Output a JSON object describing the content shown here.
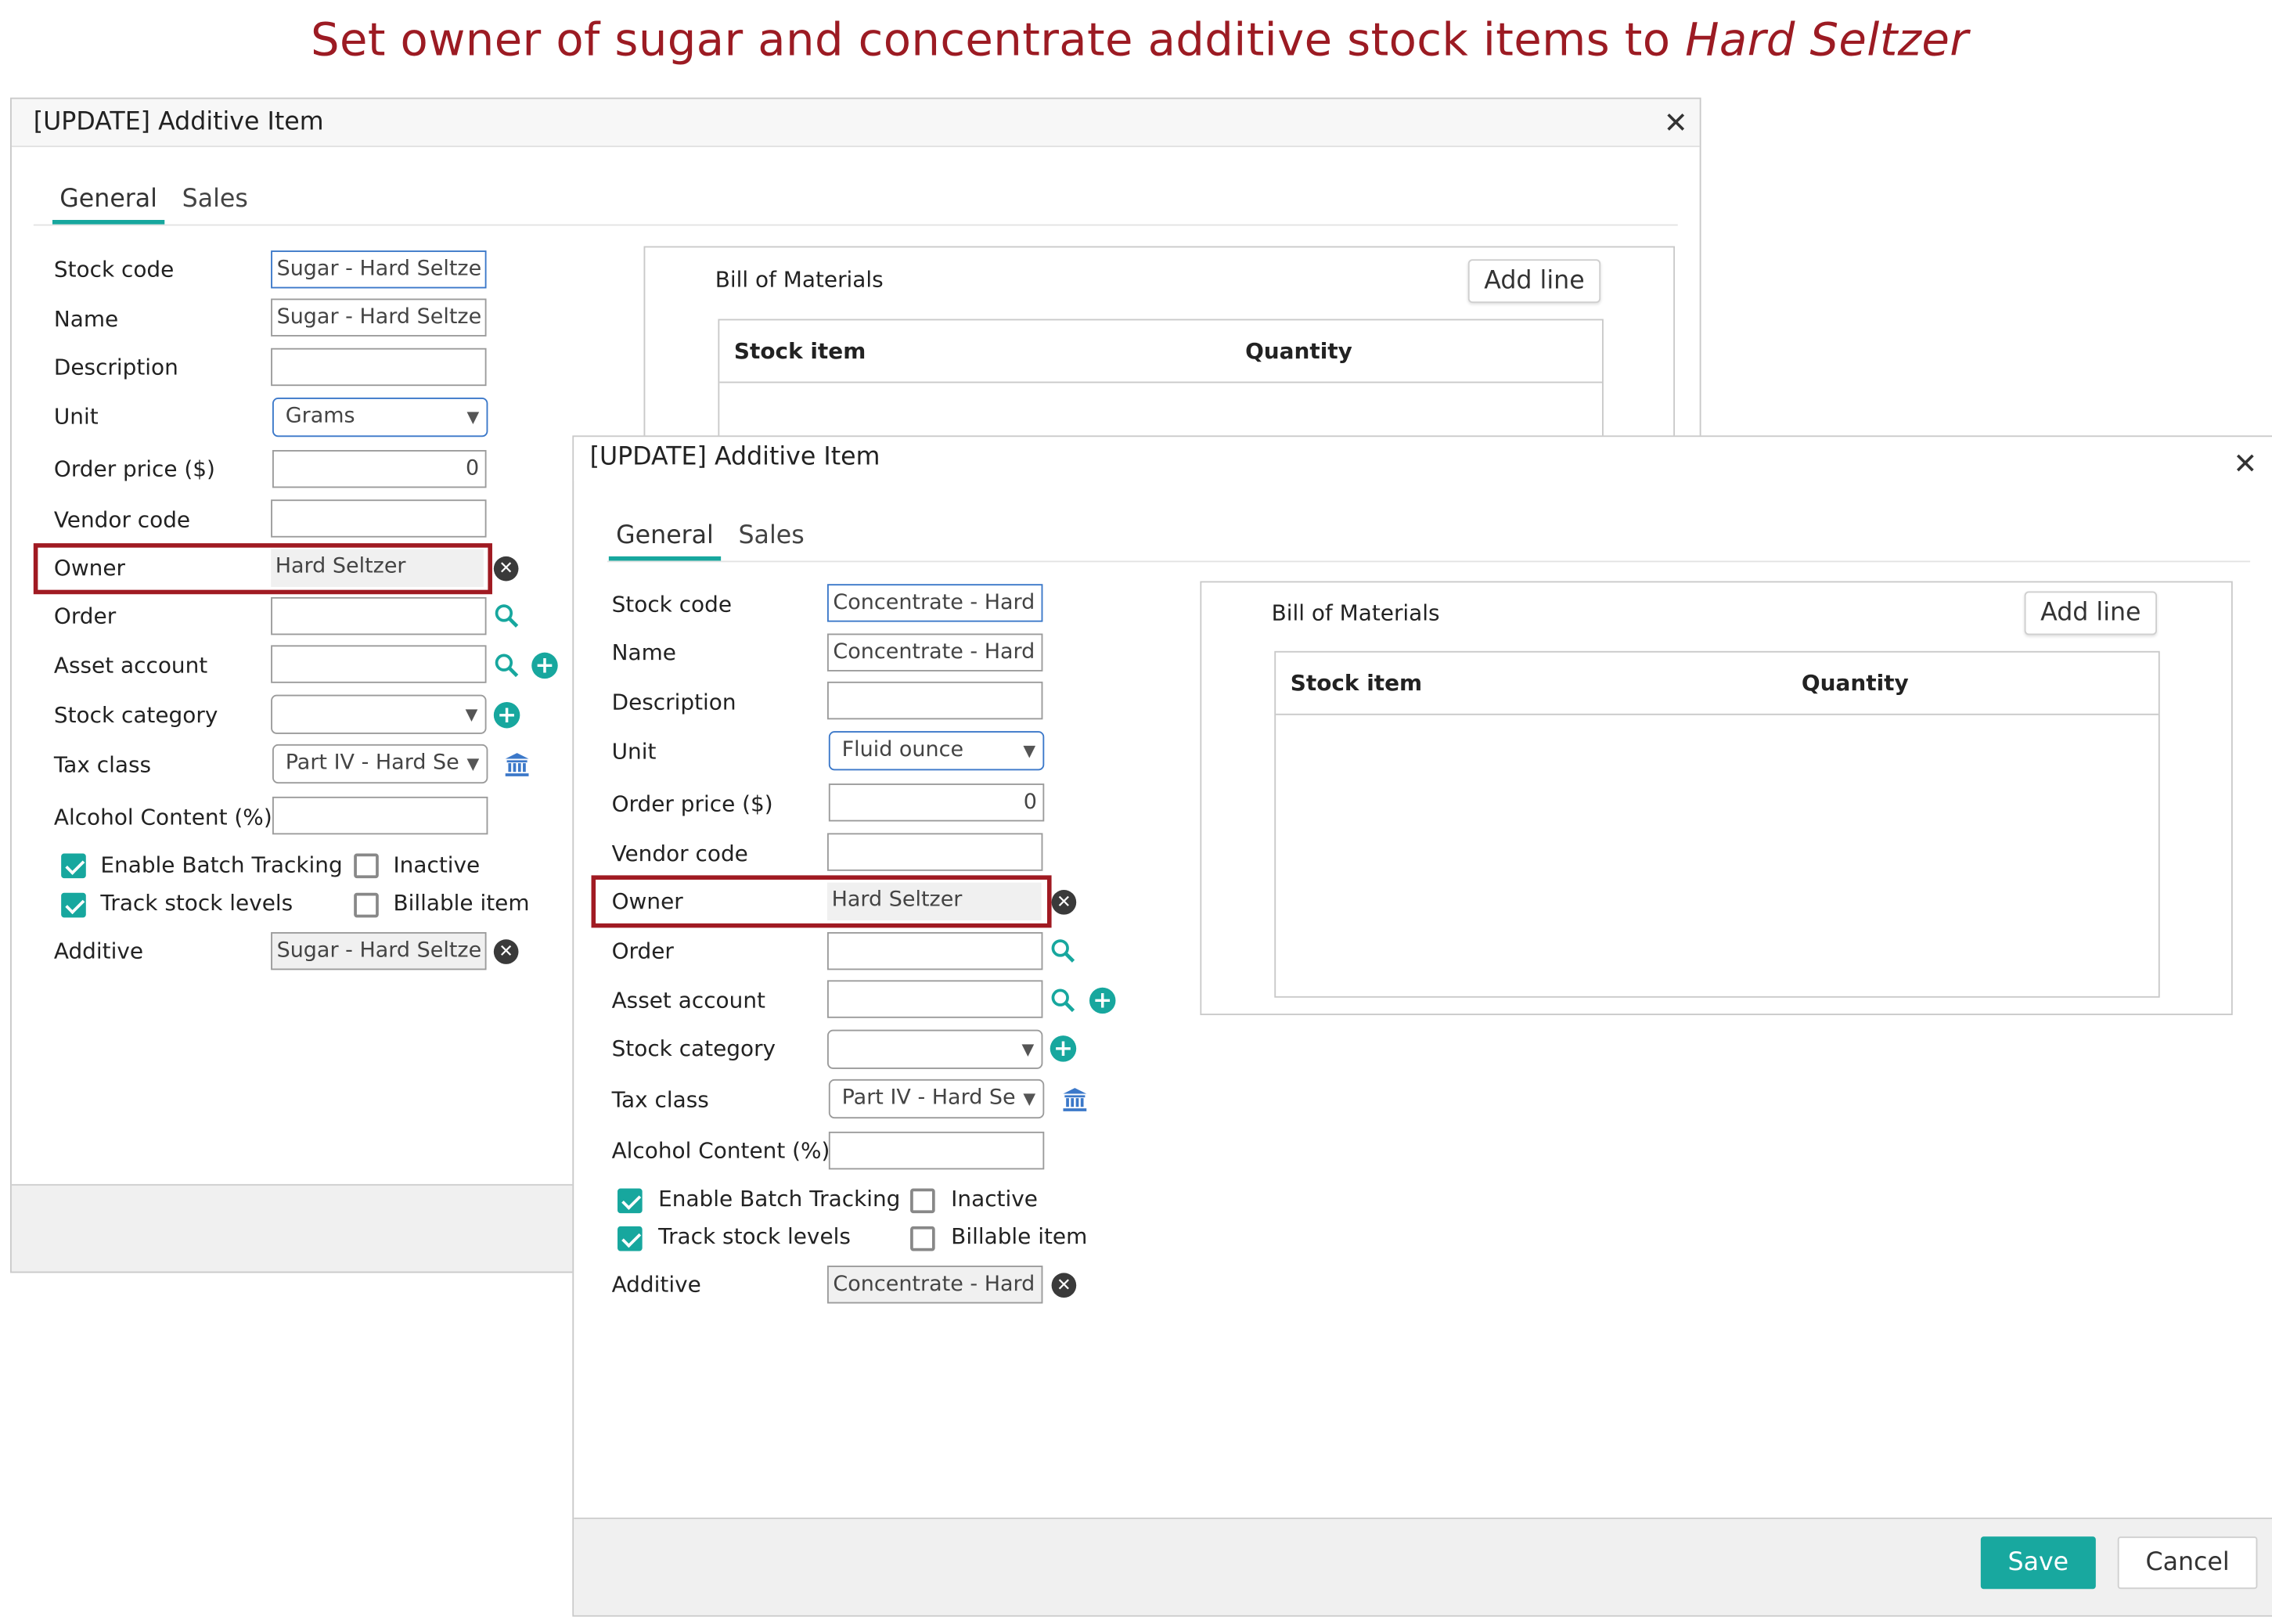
{
  "caption": {
    "text": "Set owner of sugar and concentrate additive stock items to ",
    "italic": "Hard Seltzer"
  },
  "icons": {
    "close": "close-icon",
    "clear": "clear-icon",
    "search": "search-icon",
    "add": "plus-circle-icon",
    "tax": "bank-icon",
    "dropdown": "chevron-down-icon",
    "check": "checkbox-checked-icon"
  },
  "colors": {
    "accent": "#17a79e",
    "highlight": "#a01a22",
    "caption": "#9c1b23"
  },
  "dialog1": {
    "title": "[UPDATE] Additive Item",
    "tabs": [
      "General",
      "Sales"
    ],
    "labels": {
      "stock_code": "Stock code",
      "name": "Name",
      "description": "Description",
      "unit": "Unit",
      "order_price": "Order price ($)",
      "vendor_code": "Vendor code",
      "owner": "Owner",
      "order": "Order",
      "asset_account": "Asset account",
      "stock_category": "Stock category",
      "tax_class": "Tax class",
      "alcohol_content": "Alcohol Content (%)",
      "enable_batch": "Enable Batch Tracking",
      "inactive": "Inactive",
      "track_stock": "Track stock levels",
      "billable": "Billable item",
      "additive": "Additive"
    },
    "values": {
      "stock_code": "Sugar - Hard Seltze",
      "name": "Sugar - Hard Seltze",
      "description": "",
      "unit": "Grams",
      "order_price": "0",
      "vendor_code": "",
      "owner": "Hard Seltzer",
      "order": "",
      "asset_account": "",
      "stock_category": "",
      "tax_class": "Part IV - Hard Se",
      "alcohol_content": "",
      "additive": "Sugar - Hard Seltze"
    },
    "checks": {
      "enable_batch": true,
      "inactive": false,
      "track_stock": true,
      "billable": false
    },
    "bom": {
      "title": "Bill of Materials",
      "add_line": "Add line",
      "col_stock_item": "Stock item",
      "col_quantity": "Quantity"
    }
  },
  "dialog2": {
    "title": "[UPDATE] Additive Item",
    "tabs": [
      "General",
      "Sales"
    ],
    "labels": {
      "stock_code": "Stock code",
      "name": "Name",
      "description": "Description",
      "unit": "Unit",
      "order_price": "Order price ($)",
      "vendor_code": "Vendor code",
      "owner": "Owner",
      "order": "Order",
      "asset_account": "Asset account",
      "stock_category": "Stock category",
      "tax_class": "Tax class",
      "alcohol_content": "Alcohol Content (%)",
      "enable_batch": "Enable Batch Tracking",
      "inactive": "Inactive",
      "track_stock": "Track stock levels",
      "billable": "Billable item",
      "additive": "Additive"
    },
    "values": {
      "stock_code": "Concentrate - Hard",
      "name": "Concentrate - Hard",
      "description": "",
      "unit": "Fluid ounce",
      "order_price": "0",
      "vendor_code": "",
      "owner": "Hard Seltzer",
      "order": "",
      "asset_account": "",
      "stock_category": "",
      "tax_class": "Part IV - Hard Se",
      "alcohol_content": "",
      "additive": "Concentrate - Hard"
    },
    "checks": {
      "enable_batch": true,
      "inactive": false,
      "track_stock": true,
      "billable": false
    },
    "bom": {
      "title": "Bill of Materials",
      "add_line": "Add line",
      "col_stock_item": "Stock item",
      "col_quantity": "Quantity"
    },
    "buttons": {
      "save": "Save",
      "cancel": "Cancel"
    }
  }
}
